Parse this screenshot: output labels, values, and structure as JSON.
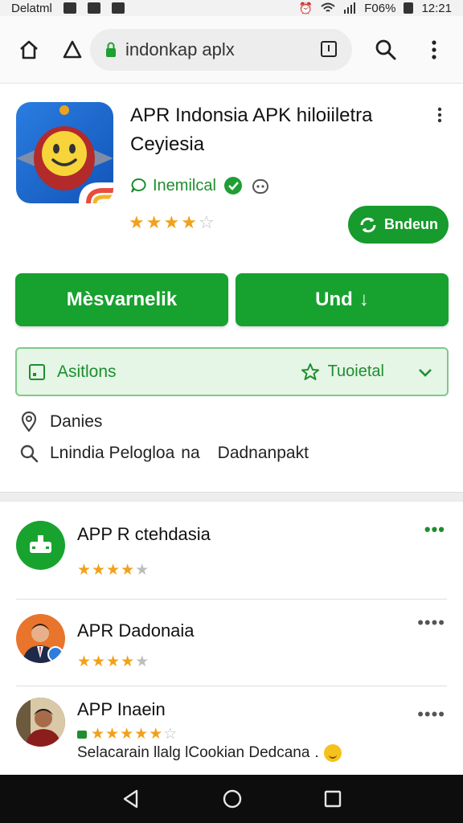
{
  "status_bar": {
    "carrier": "Delatml",
    "battery": "F06%",
    "time": "12:21"
  },
  "browser": {
    "url": "indonkap aplx",
    "home_icon": "home-icon",
    "back_icon": "triangle-back-icon",
    "lock_icon": "lock-icon",
    "tabs_icon": "tabs-icon",
    "search_icon": "search-icon",
    "menu_icon": "more-vert-icon"
  },
  "app": {
    "title": "APR Indonsia APK hiloiiletra Ceyiesia",
    "developer": "Inemilcal",
    "rating": 4,
    "rating_max": 5,
    "pill_button": "Bndeun"
  },
  "actions": {
    "primary_left": "Mèsvarnelik",
    "primary_right": "Und"
  },
  "options": {
    "left_label": "Asitlons",
    "right_label": "Tuoietal"
  },
  "info": {
    "location": "Danies",
    "search_text": "Lnindia Pelogloa",
    "search_suffix_a": "na",
    "search_suffix_b": "Dadnanpakt"
  },
  "list": [
    {
      "title": "APP R ctehdasia",
      "rating": 4
    },
    {
      "title": "APR Dadonaia",
      "rating": 4
    },
    {
      "title": "APP Inaein",
      "rating": 5,
      "description": "Selacarain llalg lCookian Dedcana"
    }
  ],
  "colors": {
    "brand_green": "#17a12f",
    "accent_green_text": "#1e8e2e",
    "star_orange": "#f2a11b",
    "options_bg": "#e5f5e6"
  }
}
